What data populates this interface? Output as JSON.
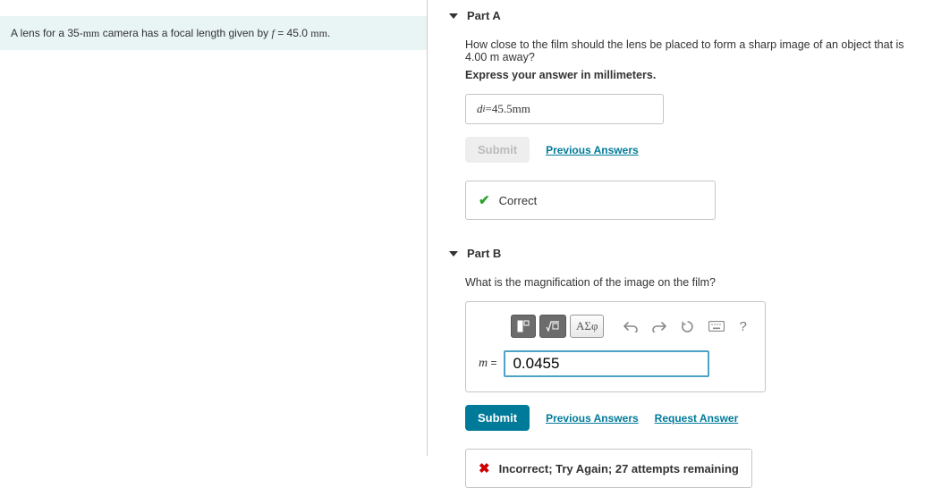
{
  "problem": {
    "prefix": "A lens for a 35-",
    "unit1": "mm",
    "mid": " camera has a focal length given by ",
    "var": "f",
    "eq": " = 45.0 ",
    "unit2": "mm",
    "suffix": "."
  },
  "partA": {
    "title": "Part A",
    "question": "How close to the film should the lens be placed to form a sharp image of an object that is 4.00 m away?",
    "instruction": "Express your answer in millimeters.",
    "answer_var": "d",
    "answer_sub": "i",
    "answer_eq": " = ",
    "answer_val": "45.5",
    "answer_unit": " mm",
    "submit_label": "Submit",
    "prev_answers": "Previous Answers",
    "feedback": "Correct"
  },
  "partB": {
    "title": "Part B",
    "question": "What is the magnification of the image on the film?",
    "answer_var": "m",
    "answer_eq": " = ",
    "input_value": "0.0455",
    "submit_label": "Submit",
    "prev_answers": "Previous Answers",
    "request_answer": "Request Answer",
    "feedback": "Incorrect; Try Again; 27 attempts remaining",
    "toolbar": {
      "greek": "ΑΣφ",
      "help": "?"
    }
  }
}
